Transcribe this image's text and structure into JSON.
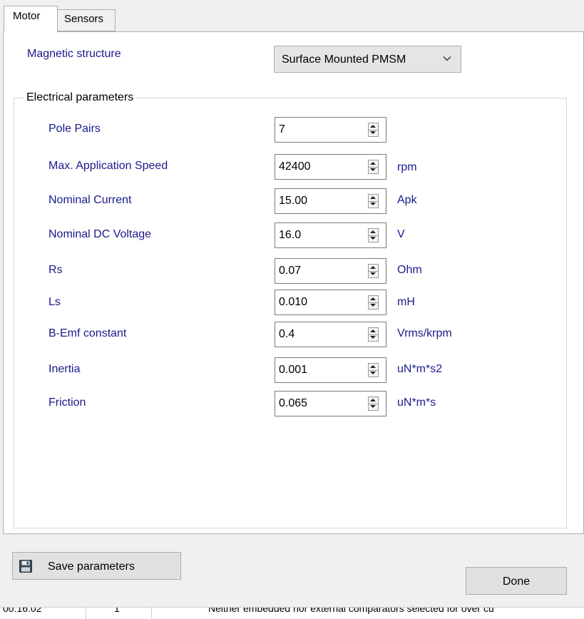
{
  "tabs": [
    {
      "label": "Motor",
      "active": true
    },
    {
      "label": "Sensors",
      "active": false
    }
  ],
  "magnetic_structure": {
    "label": "Magnetic structure",
    "selected": "Surface Mounted PMSM"
  },
  "electrical": {
    "group_title": "Electrical parameters",
    "params": [
      {
        "label": "Pole Pairs",
        "value": "7",
        "unit": ""
      },
      {
        "label": "Max. Application Speed",
        "value": "42400",
        "unit": "rpm"
      },
      {
        "label": "Nominal Current",
        "value": "15.00",
        "unit": "Apk"
      },
      {
        "label": "Nominal DC Voltage",
        "value": "16.0",
        "unit": "V"
      },
      {
        "label": "Rs",
        "value": "0.07",
        "unit": "Ohm"
      },
      {
        "label": "Ls",
        "value": "0.010",
        "unit": "mH"
      },
      {
        "label": "B-Emf constant",
        "value": "0.4",
        "unit": "Vrms/krpm"
      },
      {
        "label": "Inertia",
        "value": "0.001",
        "unit": "uN*m*s2"
      },
      {
        "label": "Friction",
        "value": "0.065",
        "unit": "uN*m*s"
      }
    ]
  },
  "buttons": {
    "save": "Save parameters",
    "done": "Done"
  },
  "status_row": {
    "time": "00:16:02",
    "col2": "1",
    "message": "Neither embedded nor external comparators selected for over cu"
  },
  "icons": {
    "save": "floppy-disk-icon",
    "dropdown": "chevron-down-icon"
  },
  "colors": {
    "label_text": "#1a1a8c",
    "tab_page_bg": "#ffffff",
    "window_bg": "#f0f0f0"
  }
}
